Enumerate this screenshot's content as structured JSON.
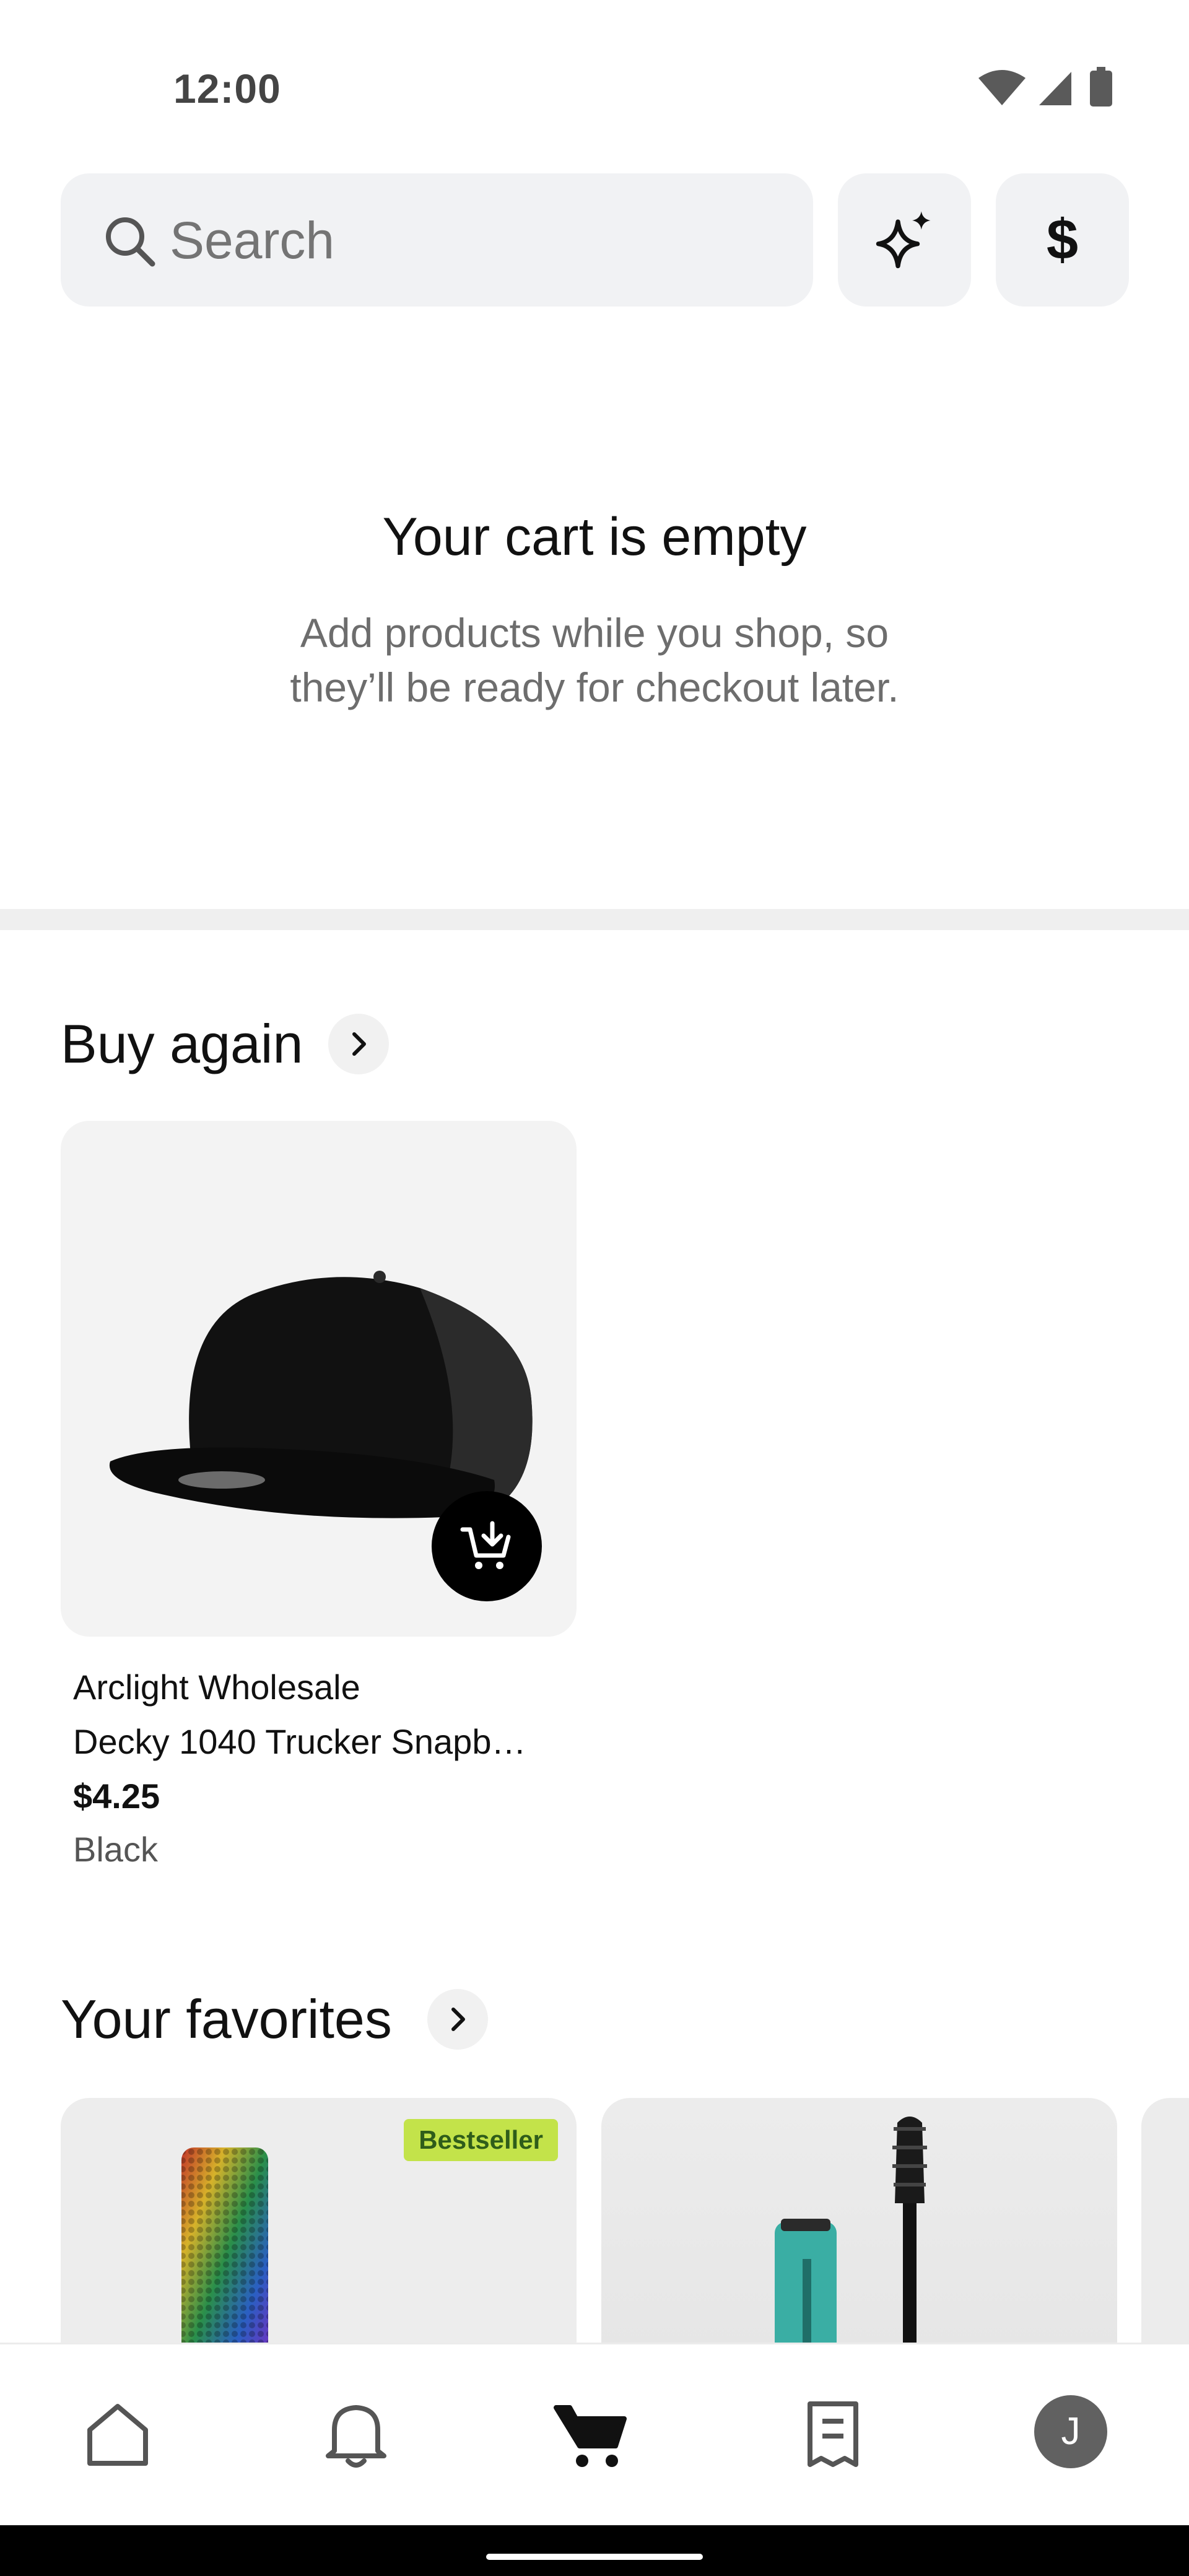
{
  "status_bar": {
    "time": "12:00",
    "icons": [
      "wifi-icon",
      "signal-icon",
      "battery-icon"
    ]
  },
  "search": {
    "placeholder": "Search"
  },
  "top_buttons": {
    "sparkle_icon": "sparkle-icon",
    "currency_label": "$"
  },
  "empty_cart": {
    "title": "Your cart is empty",
    "description_line1": "Add products while you shop, so",
    "description_line2": "they’ll be ready for checkout later."
  },
  "buy_again": {
    "title": "Buy again",
    "product": {
      "store": "Arclight Wholesale",
      "name": "Decky 1040 Trucker Snapb…",
      "price": "$4.25",
      "variant": "Black"
    }
  },
  "favorites": {
    "title": "Your favorites",
    "cards": [
      {
        "badge": "Bestseller"
      },
      {}
    ]
  },
  "bottom_nav": {
    "items": [
      "home-icon",
      "bell-icon",
      "cart-icon",
      "orders-icon"
    ],
    "profile_initial": "J"
  },
  "colors": {
    "badge_bg": "#c3e34a",
    "badge_text": "#2f5d1a",
    "search_bg": "#f1f2f4"
  }
}
